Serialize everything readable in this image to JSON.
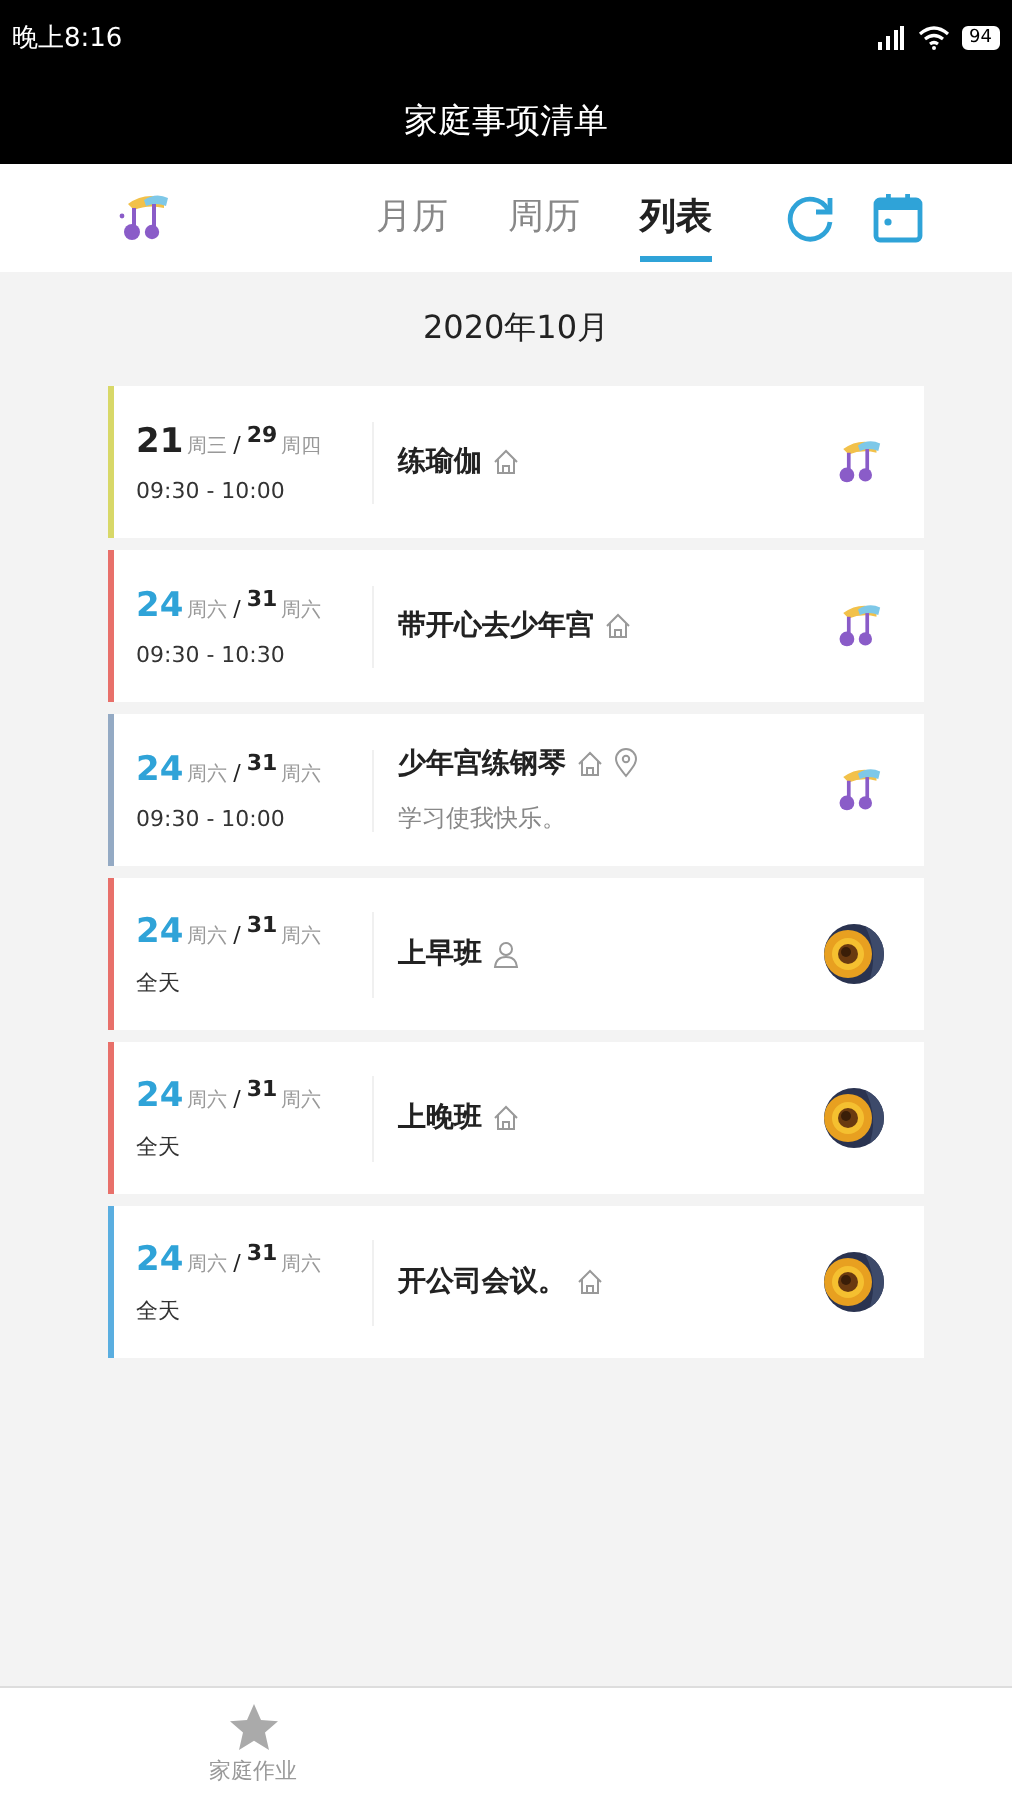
{
  "status_bar": {
    "time": "晚上8:16",
    "battery": "94"
  },
  "title": "家庭事项清单",
  "tabs": [
    {
      "label": "月历",
      "selected": false
    },
    {
      "label": "周历",
      "selected": false
    },
    {
      "label": "列表",
      "selected": true
    }
  ],
  "month": "2020年10月",
  "events": [
    {
      "color": "#d8d868",
      "start_day": "21",
      "start_highlight": false,
      "start_weekday": "周三",
      "separator": "/",
      "end_day": "29",
      "end_weekday": "周四",
      "time": "09:30 - 10:00",
      "title": "练瑜伽",
      "icons": [
        {
          "kind": "home"
        }
      ],
      "avatar": {
        "kind": "logo"
      }
    },
    {
      "color": "#e8706a",
      "start_day": "24",
      "start_highlight": true,
      "start_weekday": "周六",
      "separator": "/",
      "end_day": "31",
      "end_weekday": "周六",
      "time": "09:30 - 10:30",
      "title": "带开心去少年宫",
      "icons": [
        {
          "kind": "home"
        }
      ],
      "avatar": {
        "kind": "logo"
      }
    },
    {
      "color": "#94aac4",
      "start_day": "24",
      "start_highlight": true,
      "start_weekday": "周六",
      "separator": "/",
      "end_day": "31",
      "end_weekday": "周六",
      "time": "09:30 - 10:00",
      "title": "少年宫练钢琴",
      "icons": [
        {
          "kind": "home"
        },
        {
          "kind": "pin"
        }
      ],
      "note": "学习使我快乐。",
      "avatar": {
        "kind": "logo"
      }
    },
    {
      "color": "#e8706a",
      "start_day": "24",
      "start_highlight": true,
      "start_weekday": "周六",
      "separator": "/",
      "end_day": "31",
      "end_weekday": "周六",
      "time": "全天",
      "title": "上早班",
      "icons": [
        {
          "kind": "person"
        }
      ],
      "avatar": {
        "kind": "picture"
      }
    },
    {
      "color": "#e8706a",
      "start_day": "24",
      "start_highlight": true,
      "start_weekday": "周六",
      "separator": "/",
      "end_day": "31",
      "end_weekday": "周六",
      "time": "全天",
      "title": "上晚班",
      "icons": [
        {
          "kind": "home"
        }
      ],
      "avatar": {
        "kind": "picture"
      }
    },
    {
      "color": "#5aaee0",
      "start_day": "24",
      "start_highlight": true,
      "start_weekday": "周六",
      "separator": "/",
      "end_day": "31",
      "end_weekday": "周六",
      "time": "全天",
      "title": "开公司会议。",
      "icons": [
        {
          "kind": "home"
        }
      ],
      "avatar": {
        "kind": "picture"
      }
    }
  ],
  "bottom_nav": [
    {
      "label": "家庭作业"
    }
  ]
}
